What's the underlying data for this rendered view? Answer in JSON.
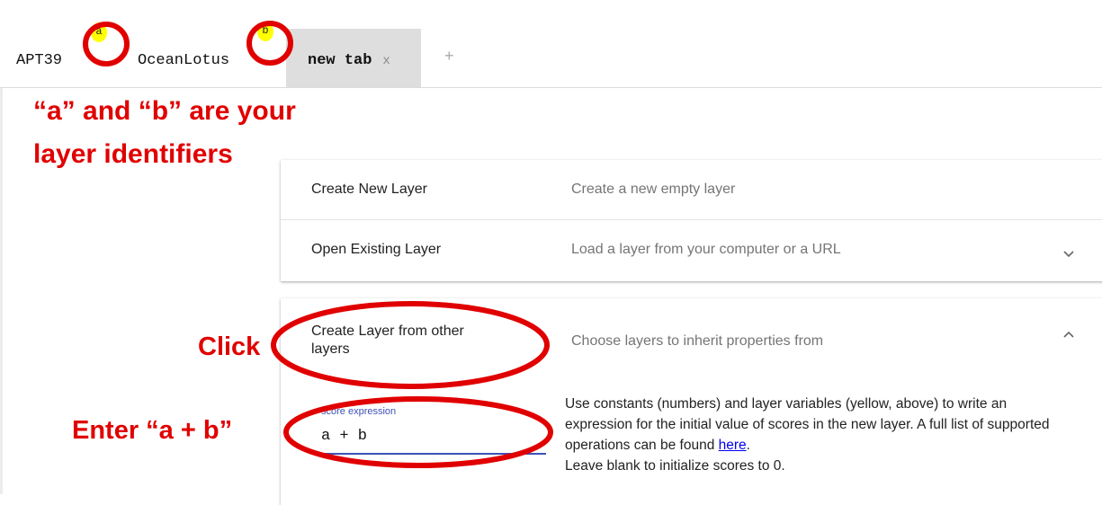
{
  "tabs": [
    {
      "label": "APT39",
      "identifier": "a"
    },
    {
      "label": "OceanLotus",
      "identifier": "b"
    },
    {
      "label": "new tab",
      "close": "x"
    }
  ],
  "new_tab_plus": "+",
  "annotations": {
    "identifiers_line1": "“a” and “b” are your",
    "identifiers_line2": "layer identifiers",
    "click": "Click",
    "enter": "Enter “a + b”"
  },
  "options": [
    {
      "label": "Create New Layer",
      "description": "Create a new empty layer"
    },
    {
      "label": "Open Existing Layer",
      "description": "Load a layer from your computer or a URL",
      "chevron": "chevron-down-icon"
    }
  ],
  "create_from_layers": {
    "label_line1": "Create Layer from other",
    "label_line2": "layers",
    "description": "Choose layers to inherit properties from",
    "chevron": "chevron-up-icon",
    "score_expression_label": "score expression",
    "score_expression_value": "a + b",
    "help_text_1": "Use constants (numbers) and layer variables (yellow, above) to write an expression for the initial value of scores in the new layer. A full list of supported operations can be found ",
    "help_link": "here",
    "help_text_2": ".",
    "help_text_3": "Leave blank to initialize scores to 0."
  },
  "colors": {
    "annotation_red": "#e00000",
    "identifier_yellow": "#ffff00",
    "accent_blue": "#3f51b5"
  }
}
